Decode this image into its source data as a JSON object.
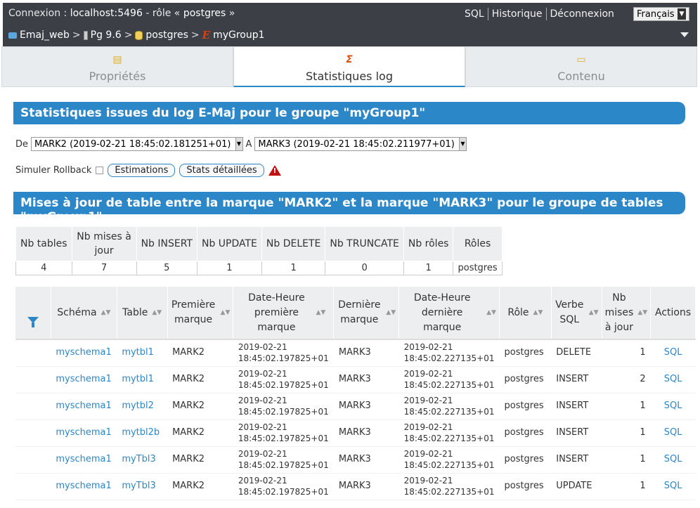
{
  "topbar": {
    "connexion_prefix": "Connexion : ",
    "host": "localhost:5496",
    "role_prefix": " - rôle « ",
    "role": "postgres",
    "role_suffix": " »",
    "nav": [
      "SQL",
      "Historique",
      "Déconnexion"
    ],
    "language": "Français"
  },
  "breadcrumb": [
    "Emaj_web",
    "Pg 9.6",
    "postgres",
    "myGroup1"
  ],
  "tabs": [
    {
      "label": "Propriétés",
      "icon": "list-icon"
    },
    {
      "label": "Statistiques log",
      "icon": "sigma-icon"
    },
    {
      "label": "Contenu",
      "icon": "folder-icon"
    }
  ],
  "section1": {
    "title": "Statistiques issues du log E-Maj pour le groupe \"myGroup1\""
  },
  "marks": {
    "from_label": "De",
    "from_value": "MARK2 (2019-02-21 18:45:02.181251+01)",
    "to_label": "A",
    "to_value": "MARK3 (2019-02-21 18:45:02.211977+01)"
  },
  "simulate": {
    "label": "Simuler Rollback",
    "estimations": "Estimations",
    "stats_detail": "Stats détaillées"
  },
  "section2": {
    "title": "Mises à jour de table entre la marque \"MARK2\" et la marque \"MARK3\" pour le groupe de tables \"myGroup1\""
  },
  "summary": {
    "headers": [
      "Nb tables",
      "Nb mises à jour",
      "Nb INSERT",
      "Nb UPDATE",
      "Nb DELETE",
      "Nb TRUNCATE",
      "Nb rôles",
      "Rôles"
    ],
    "values": [
      "4",
      "7",
      "5",
      "1",
      "1",
      "0",
      "1",
      "postgres"
    ]
  },
  "detail": {
    "headers": [
      "Schéma",
      "Table",
      "Première marque",
      "Date-Heure première marque",
      "Dernière marque",
      "Date-Heure dernière marque",
      "Rôle",
      "Verbe SQL",
      "Nb mises à jour",
      "Actions"
    ],
    "rows": [
      {
        "schema": "myschema1",
        "table": "mytbl1",
        "first_mark": "MARK2",
        "first_dt1": "2019-02-21",
        "first_dt2": "18:45:02.197825+01",
        "last_mark": "MARK3",
        "last_dt1": "2019-02-21",
        "last_dt2": "18:45:02.227135+01",
        "role": "postgres",
        "verb": "DELETE",
        "count": "1",
        "action": "SQL"
      },
      {
        "schema": "myschema1",
        "table": "mytbl1",
        "first_mark": "MARK2",
        "first_dt1": "2019-02-21",
        "first_dt2": "18:45:02.197825+01",
        "last_mark": "MARK3",
        "last_dt1": "2019-02-21",
        "last_dt2": "18:45:02.227135+01",
        "role": "postgres",
        "verb": "INSERT",
        "count": "2",
        "action": "SQL"
      },
      {
        "schema": "myschema1",
        "table": "mytbl2",
        "first_mark": "MARK2",
        "first_dt1": "2019-02-21",
        "first_dt2": "18:45:02.197825+01",
        "last_mark": "MARK3",
        "last_dt1": "2019-02-21",
        "last_dt2": "18:45:02.227135+01",
        "role": "postgres",
        "verb": "INSERT",
        "count": "1",
        "action": "SQL"
      },
      {
        "schema": "myschema1",
        "table": "mytbl2b",
        "first_mark": "MARK2",
        "first_dt1": "2019-02-21",
        "first_dt2": "18:45:02.197825+01",
        "last_mark": "MARK3",
        "last_dt1": "2019-02-21",
        "last_dt2": "18:45:02.227135+01",
        "role": "postgres",
        "verb": "INSERT",
        "count": "1",
        "action": "SQL"
      },
      {
        "schema": "myschema1",
        "table": "myTbl3",
        "first_mark": "MARK2",
        "first_dt1": "2019-02-21",
        "first_dt2": "18:45:02.197825+01",
        "last_mark": "MARK3",
        "last_dt1": "2019-02-21",
        "last_dt2": "18:45:02.227135+01",
        "role": "postgres",
        "verb": "INSERT",
        "count": "1",
        "action": "SQL"
      },
      {
        "schema": "myschema1",
        "table": "myTbl3",
        "first_mark": "MARK2",
        "first_dt1": "2019-02-21",
        "first_dt2": "18:45:02.197825+01",
        "last_mark": "MARK3",
        "last_dt1": "2019-02-21",
        "last_dt2": "18:45:02.227135+01",
        "role": "postgres",
        "verb": "UPDATE",
        "count": "1",
        "action": "SQL"
      }
    ]
  }
}
